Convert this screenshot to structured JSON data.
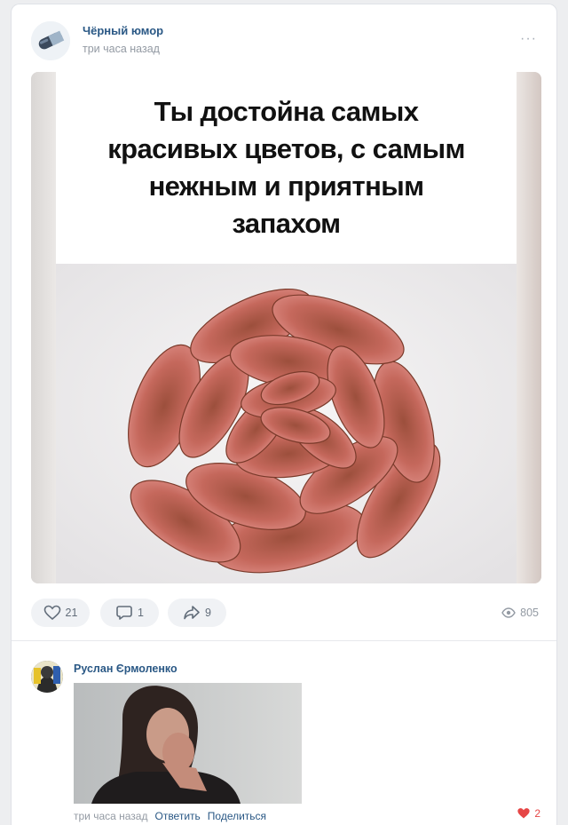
{
  "post": {
    "author": "Чёрный юмор",
    "time": "три часа назад",
    "more_label": "···",
    "avatar_icon": "pill-icon",
    "meme_caption": "Ты достойна самых красивых цветов, с самым нежным и приятным запахом",
    "actions": {
      "likes": "21",
      "comments": "1",
      "shares": "9",
      "views": "805"
    }
  },
  "comment": {
    "author": "Руслан Єрмоленко",
    "time": "три часа назад",
    "reply_label": "Ответить",
    "share_label": "Поделиться",
    "likes": "2",
    "like_color": "#e64646"
  },
  "colors": {
    "link": "#2a5885",
    "muted": "#939aa3",
    "background": "#edeef0"
  }
}
